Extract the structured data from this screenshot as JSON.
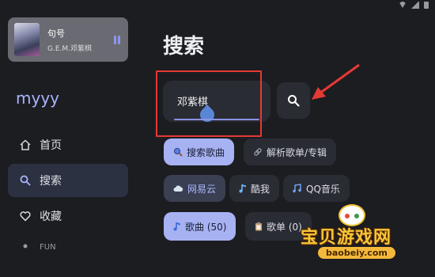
{
  "now_playing": {
    "title": "句号",
    "artist": "G.E.M.邓紫棋"
  },
  "sidebar": {
    "app_title": "myyy",
    "items": [
      {
        "label": "首页",
        "icon": "home-icon"
      },
      {
        "label": "搜索",
        "icon": "search-icon",
        "active": true
      },
      {
        "label": "收藏",
        "icon": "heart-icon"
      },
      {
        "label": "FUN",
        "icon": "fun-icon"
      }
    ]
  },
  "main": {
    "page_title": "搜索",
    "search_value": "邓紫棋",
    "mode_chips": [
      {
        "label": "搜索歌曲",
        "icon": "magnifier-icon",
        "selected": true
      },
      {
        "label": "解析歌单/专辑",
        "icon": "link-icon",
        "selected": false
      }
    ],
    "source_chips": [
      {
        "label": "网易云",
        "icon": "cloud-icon",
        "selected": true
      },
      {
        "label": "酷我",
        "icon": "music-note-icon",
        "selected": false
      },
      {
        "label": "QQ音乐",
        "icon": "music-notes-icon",
        "selected": false
      }
    ],
    "type_chips": [
      {
        "label": "歌曲 (50)",
        "icon": "music-note-icon",
        "selected": true
      },
      {
        "label": "歌单 (0)",
        "icon": "clipboard-icon",
        "selected": false
      }
    ]
  },
  "watermark": {
    "text": "宝贝游戏网",
    "url": "baobeiy.com"
  },
  "colors": {
    "background": "#1c1d21",
    "accent": "#a7b2f3",
    "annotation_red": "#e53935"
  }
}
